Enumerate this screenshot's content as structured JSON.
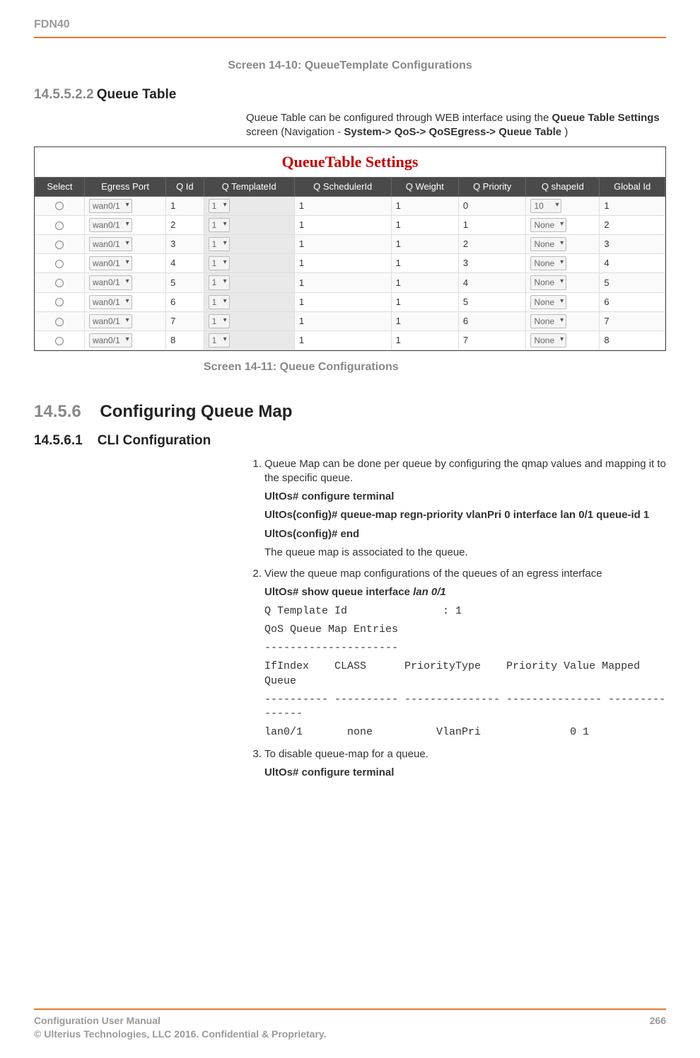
{
  "header": {
    "product": "FDN40"
  },
  "caption1": "Screen 14-10: QueueTemplate Configurations",
  "sec1": {
    "num": "14.5.5.2.2",
    "title": "Queue Table",
    "intro_l1": "Queue Table can be configured through WEB interface using the ",
    "intro_b1": "Queue Table Settings",
    "intro_l2": " screen (Navigation - ",
    "intro_b2": "System-> QoS-> QoSEgress-> Queue Table",
    "intro_l3": ")"
  },
  "qtable": {
    "title": "QueueTable Settings",
    "headers": [
      "Select",
      "Egress Port",
      "Q Id",
      "Q TemplateId",
      "Q SchedulerId",
      "Q Weight",
      "Q Priority",
      "Q shapeId",
      "Global Id"
    ],
    "rows": [
      {
        "port": "wan0/1",
        "qid": "1",
        "tpl": "1",
        "sch": "1",
        "wt": "1",
        "pri": "0",
        "shape": "10",
        "gid": "1"
      },
      {
        "port": "wan0/1",
        "qid": "2",
        "tpl": "1",
        "sch": "1",
        "wt": "1",
        "pri": "1",
        "shape": "None",
        "gid": "2"
      },
      {
        "port": "wan0/1",
        "qid": "3",
        "tpl": "1",
        "sch": "1",
        "wt": "1",
        "pri": "2",
        "shape": "None",
        "gid": "3"
      },
      {
        "port": "wan0/1",
        "qid": "4",
        "tpl": "1",
        "sch": "1",
        "wt": "1",
        "pri": "3",
        "shape": "None",
        "gid": "4"
      },
      {
        "port": "wan0/1",
        "qid": "5",
        "tpl": "1",
        "sch": "1",
        "wt": "1",
        "pri": "4",
        "shape": "None",
        "gid": "5"
      },
      {
        "port": "wan0/1",
        "qid": "6",
        "tpl": "1",
        "sch": "1",
        "wt": "1",
        "pri": "5",
        "shape": "None",
        "gid": "6"
      },
      {
        "port": "wan0/1",
        "qid": "7",
        "tpl": "1",
        "sch": "1",
        "wt": "1",
        "pri": "6",
        "shape": "None",
        "gid": "7"
      },
      {
        "port": "wan0/1",
        "qid": "8",
        "tpl": "1",
        "sch": "1",
        "wt": "1",
        "pri": "7",
        "shape": "None",
        "gid": "8"
      }
    ]
  },
  "caption2": "Screen 14-11: Queue Configurations",
  "sec2": {
    "num": "14.5.6",
    "title": "Configuring Queue Map"
  },
  "sec3": {
    "num": "14.5.6.1",
    "title": "CLI Configuration"
  },
  "cli": {
    "li1": "Queue Map can be done per queue by configuring the qmap values and mapping it to the specific queue.",
    "cmd1": "UltOs# configure terminal",
    "cmd2": "UltOs(config)# queue-map regn-priority vlanPri 0 interface lan 0/1 queue-id 1",
    "cmd3": "UltOs(config)# end",
    "note1": "The queue map is associated to the queue.",
    "li2": "View the queue map configurations of the queues of an egress interface",
    "cmd4a": "UltOs# show queue interface ",
    "cmd4b": "lan 0/1",
    "out1": "Q Template Id               : 1",
    "out2": "QoS Queue Map Entries",
    "out3": "---------------------",
    "out4": "IfIndex    CLASS      PriorityType    Priority Value Mapped Queue",
    "out5": "---------- ---------- --------------- --------------- ---------------",
    "out6": "lan0/1       none          VlanPri              0 1",
    "li3": "To disable queue-map for a queue.",
    "cmd5": "UltOs# configure terminal"
  },
  "footer": {
    "left1": "Configuration User Manual",
    "left2": "© Ulterius Technologies, LLC 2016. Confidential & Proprietary.",
    "page": "266"
  }
}
